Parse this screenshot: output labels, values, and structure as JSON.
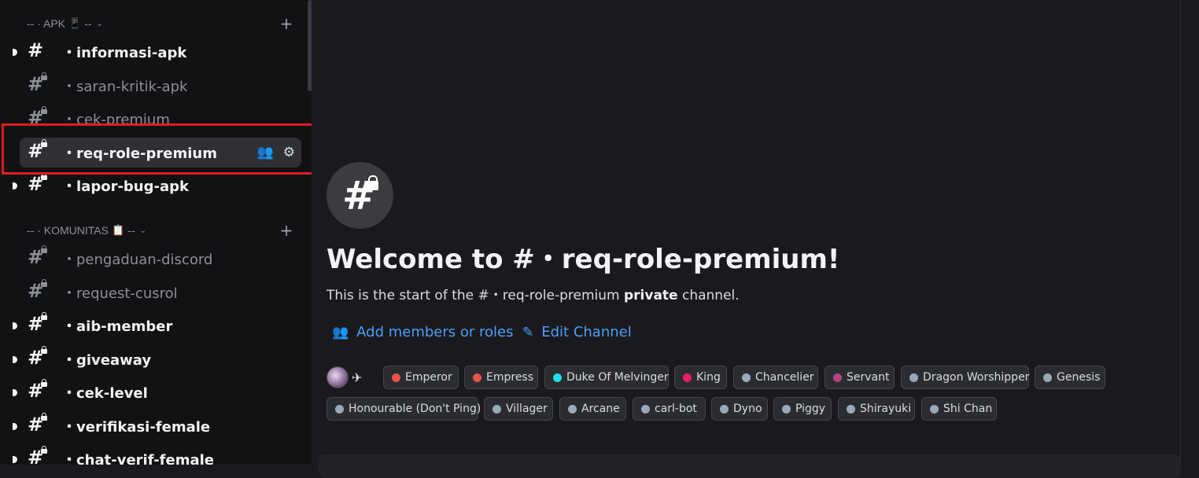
{
  "sidebar": {
    "categories": [
      {
        "prefix": "-- · APK",
        "emoji": "📱",
        "suffix": "--",
        "chevron": "⌄",
        "plus": "+"
      },
      {
        "prefix": "-- · KOMUNITAS",
        "emoji": "📋",
        "suffix": "--",
        "chevron": "⌄",
        "plus": "+"
      }
    ],
    "channels": [
      {
        "label": "・informasi-apk",
        "unread": true,
        "locked": false
      },
      {
        "label": "・saran-kritik-apk",
        "unread": false,
        "locked": true
      },
      {
        "label": "・cek-premium",
        "unread": false,
        "locked": true
      },
      {
        "label": "・req-role-premium",
        "unread": false,
        "locked": true,
        "selected": true
      },
      {
        "label": "・lapor-bug-apk",
        "unread": true,
        "locked": true
      },
      {
        "label": "・pengaduan-discord",
        "unread": false,
        "locked": true
      },
      {
        "label": "・request-cusrol",
        "unread": false,
        "locked": true
      },
      {
        "label": "・aib-member",
        "unread": true,
        "locked": true
      },
      {
        "label": "・giveaway",
        "unread": true,
        "locked": true
      },
      {
        "label": "・cek-level",
        "unread": true,
        "locked": true
      },
      {
        "label": "・verifikasi-female",
        "unread": true,
        "locked": true
      },
      {
        "label": "・chat-verif-female",
        "unread": true,
        "locked": true
      }
    ],
    "selected_actions": {
      "invite_icon": "add-member-icon",
      "settings_icon": "gear-icon"
    }
  },
  "main": {
    "hash_symbol": "#",
    "welcome_title": "Welcome to #・req-role-premium!",
    "sub_prefix": "This is the start of the #・req-role-premium ",
    "sub_bold": "private",
    "sub_suffix": " channel.",
    "add_members_label": "Add members or roles",
    "edit_channel_label": "Edit Channel",
    "roles": [
      {
        "name": "Emperor",
        "color": "#e8524a"
      },
      {
        "name": "Empress",
        "color": "#e8524a"
      },
      {
        "name": "Duke Of Melvinger",
        "color": "#1ee0e8"
      },
      {
        "name": "King",
        "color": "#e91e63"
      },
      {
        "name": "Chancelier",
        "color": "#99aab5"
      },
      {
        "name": "Servant",
        "color": "#b0467a"
      },
      {
        "name": "Dragon Worshipper",
        "color": "#99aab5"
      },
      {
        "name": "Genesis",
        "color": "#99aab5"
      },
      {
        "name": "Honourable (Don't Ping)",
        "color": "#99aab5"
      },
      {
        "name": "Villager",
        "color": "#99aab5"
      },
      {
        "name": "Arcane",
        "color": "#99aab5"
      },
      {
        "name": "carl-bot",
        "color": "#99aab5"
      },
      {
        "name": "Dyno",
        "color": "#99aab5"
      },
      {
        "name": "Piggy",
        "color": "#99aab5"
      },
      {
        "name": "Shirayuki",
        "color": "#99aab5"
      },
      {
        "name": "Shi Chan",
        "color": "#99aab5"
      }
    ]
  }
}
